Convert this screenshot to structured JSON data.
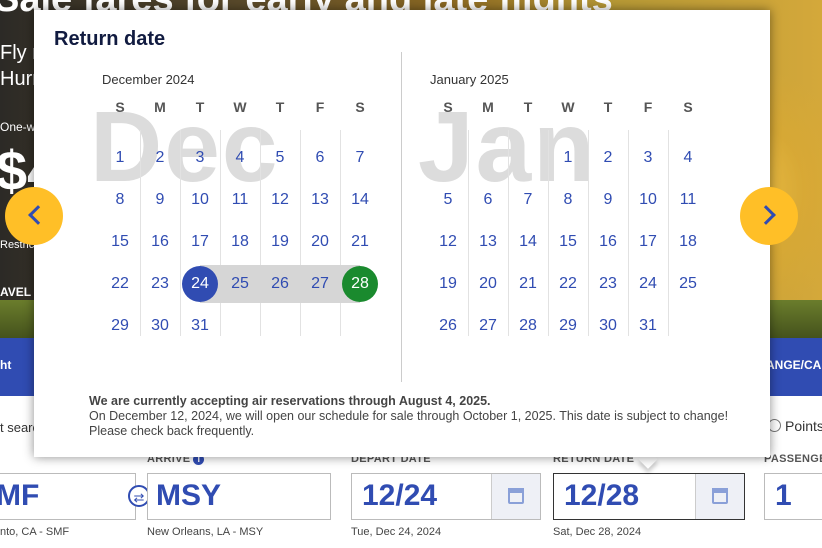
{
  "hero": {
    "title": "Sale fares for early and late flights",
    "subtitle_1": "Fly n",
    "subtitle_2": "Hurry",
    "oneway_label": "One-w",
    "price_partial": "$4",
    "restrictions_label": "Restrict",
    "travel_label": "AVEL A"
  },
  "nav": {
    "left_label": "ht",
    "right_label": "ANGE/CA"
  },
  "search_label": "t searc",
  "points_label": "Points",
  "form": {
    "arrive_label": "ARRIVE",
    "depart_label": "DEPART DATE",
    "return_label": "RETURN DATE",
    "passengers_label": "PASSENGE",
    "from_value": "MF",
    "from_sub": "nto, CA - SMF",
    "arrive_value": "MSY",
    "arrive_sub": "New Orleans, LA - MSY",
    "depart_value": "12/24",
    "depart_sub": "Tue, Dec 24, 2024",
    "return_value": "12/28",
    "return_sub": "Sat, Dec 28, 2024",
    "passengers_value": "1"
  },
  "popup": {
    "title": "Return date",
    "weekdays": [
      "S",
      "M",
      "T",
      "W",
      "T",
      "F",
      "S"
    ],
    "months": [
      {
        "label": "December 2024",
        "watermark": "Dec",
        "first_weekday": 0,
        "days": [
          "1",
          "2",
          "3",
          "4",
          "5",
          "6",
          "7",
          "8",
          "9",
          "10",
          "11",
          "12",
          "13",
          "14",
          "15",
          "16",
          "17",
          "18",
          "19",
          "20",
          "21",
          "22",
          "23",
          "24",
          "25",
          "26",
          "27",
          "28",
          "29",
          "30",
          "31"
        ],
        "selected_start": "24",
        "selected_end": "28"
      },
      {
        "label": "January 2025",
        "watermark": "Jan",
        "first_weekday": 3,
        "days": [
          "1",
          "2",
          "3",
          "4",
          "5",
          "6",
          "7",
          "8",
          "9",
          "10",
          "11",
          "12",
          "13",
          "14",
          "15",
          "16",
          "17",
          "18",
          "19",
          "20",
          "21",
          "22",
          "23",
          "24",
          "25",
          "26",
          "27",
          "28",
          "29",
          "30",
          "31"
        ]
      }
    ],
    "notice_bold": "We are currently accepting air reservations through August 4, 2025.",
    "notice_text": "On December 12, 2024, we will open our schedule for sale through October 1, 2025. This date is subject to change! Please check back frequently."
  },
  "colors": {
    "brand_blue": "#304cb2",
    "accent_yellow": "#ffbf27",
    "end_green": "#1a8a2e",
    "range_grey": "#d6d6d6"
  },
  "icons": {
    "prev": "chevron-left-icon",
    "next": "chevron-right-icon",
    "calendar": "calendar-icon",
    "swap": "swap-icon",
    "info": "info-icon"
  }
}
